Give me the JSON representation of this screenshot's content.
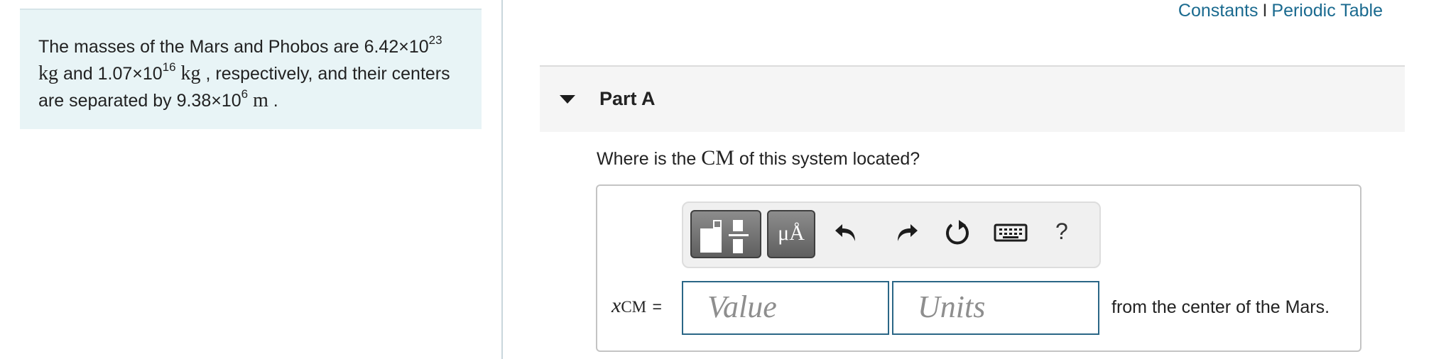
{
  "problem": {
    "text_1": "The masses of the Mars and Phobos are 6.42×10",
    "exp_1": "23",
    "unit_1": "kg",
    "text_2": " and 1.07×10",
    "exp_2": "16",
    "unit_2": "kg",
    "text_3": " , respectively, and their centers are separated by 9.38×10",
    "exp_3": "6",
    "unit_3": "m",
    "text_4": " ."
  },
  "links": {
    "constants": "Constants",
    "separator": "I",
    "periodic_table": "Periodic Table"
  },
  "part": {
    "title": "Part A",
    "question_pre": "Where is the ",
    "question_cm": "CM",
    "question_post": " of this system located?"
  },
  "toolbar": {
    "symbols_label": "μÅ",
    "help_label": "?",
    "icons": [
      "templates-icon",
      "undo-icon",
      "redo-icon",
      "reset-icon",
      "keyboard-icon"
    ]
  },
  "answer": {
    "var": "x",
    "sub": "CM",
    "eq": "=",
    "value_placeholder": "Value",
    "units_placeholder": "Units",
    "suffix": "from the center of the Mars."
  },
  "colors": {
    "problem_bg": "#e8f4f6",
    "link": "#1a6a8f",
    "field_border": "#2a6686"
  }
}
